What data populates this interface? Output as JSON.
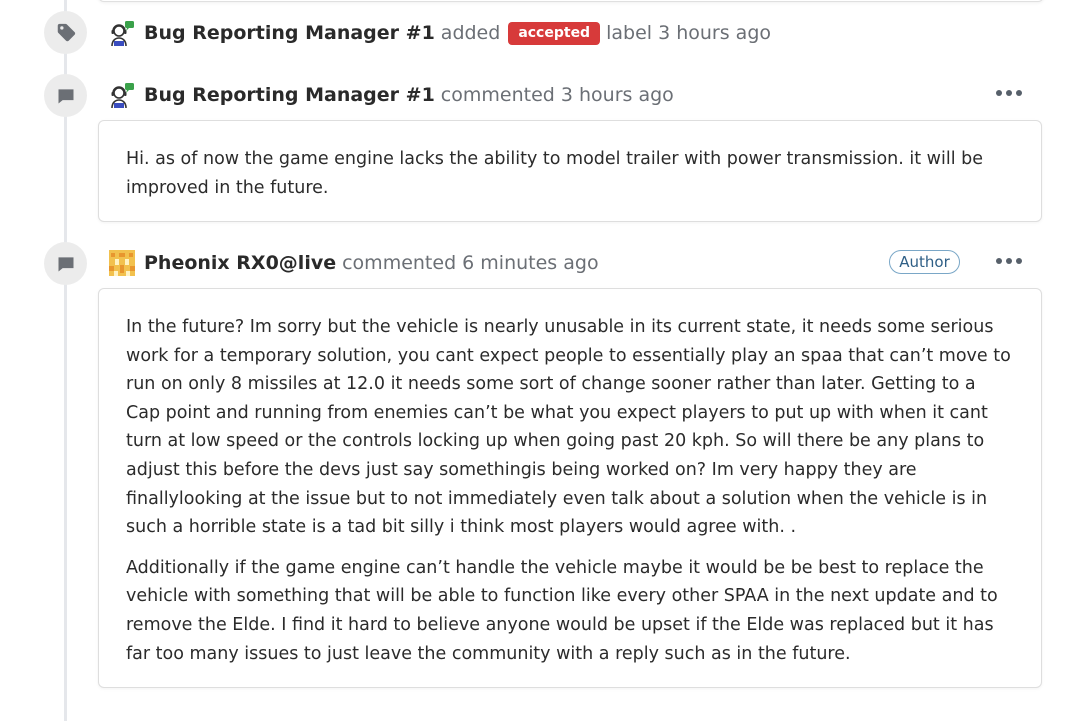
{
  "events": [
    {
      "type": "label",
      "actor": "Bug Reporting Manager #1",
      "action": "added",
      "label": "accepted",
      "label_color": "#d73a3a",
      "suffix": "label 3 hours ago",
      "icon": "tag-icon"
    },
    {
      "type": "comment",
      "actor": "Bug Reporting Manager #1",
      "meta": "commented 3 hours ago",
      "icon": "comment-icon",
      "body": [
        "Hi. as of now the game engine lacks the ability to model trailer with power transmission. it will be improved in the future."
      ]
    },
    {
      "type": "comment",
      "actor": "Pheonix RX0@live",
      "meta": "commented 6 minutes ago",
      "role": "Author",
      "icon": "comment-icon",
      "body": [
        "In the future? Im sorry but the vehicle is nearly unusable in its current state, it needs some serious work for a temporary solution, you cant expect people to essentially play an spaa that can’t move to run on only 8 missiles at 12.0 it needs some sort of change sooner rather than later. Getting to a Cap point and running from enemies can’t be what you expect players to put up with when it cant turn at low speed or the controls locking up when going past 20 kph. So will there be any plans to adjust this before the devs just say somethingis being worked on? Im very happy they are finallylooking at the issue but to not immediately even talk about a solution when the vehicle is in such a horrible state is a tad bit silly i think most players would agree with. .",
        "Additionally if the game engine can’t handle the vehicle maybe it would be be best to replace the vehicle with something that will be able to function like every other SPAA in the next update and to remove the Elde. I find it hard to believe anyone would be upset if the Elde was replaced but it has far too many issues to just leave the community with a reply such as in the future."
      ]
    }
  ]
}
